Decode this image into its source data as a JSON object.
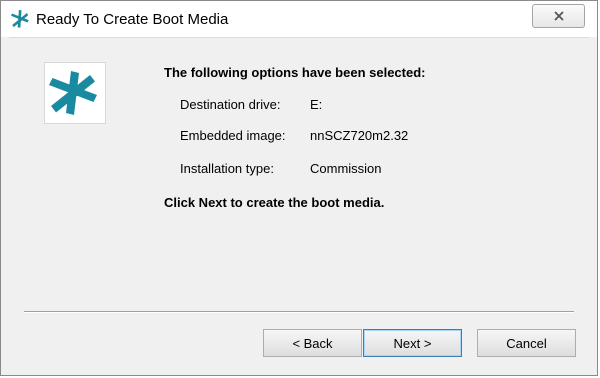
{
  "window": {
    "title": "Ready To Create Boot Media",
    "accent_color": "#1a8aa0"
  },
  "content": {
    "heading": "The following options have been selected:",
    "rows": [
      {
        "label": "Destination drive:",
        "value": "E:"
      },
      {
        "label": "Embedded image:",
        "value": "nnSCZ720m2.32"
      },
      {
        "label": "Installation type:",
        "value": "Commission"
      }
    ],
    "footer": "Click Next to create the boot media."
  },
  "buttons": {
    "back_label": "< Back",
    "next_label": "Next >",
    "cancel_label": "Cancel"
  }
}
